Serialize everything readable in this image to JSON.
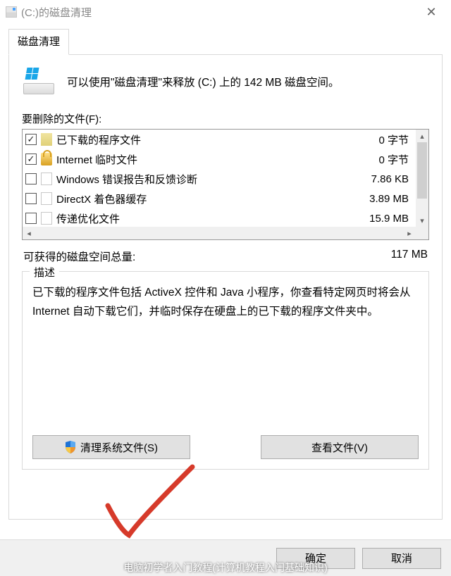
{
  "window": {
    "title": "(C:)的磁盘清理"
  },
  "tab": {
    "label": "磁盘清理"
  },
  "intro": {
    "text": "可以使用\"磁盘清理\"来释放  (C:) 上的 142 MB 磁盘空间。"
  },
  "files": {
    "label": "要删除的文件(F):",
    "items": [
      {
        "checked": true,
        "icon": "folder",
        "name": "已下载的程序文件",
        "size": "0 字节"
      },
      {
        "checked": true,
        "icon": "lock",
        "name": "Internet 临时文件",
        "size": "0 字节"
      },
      {
        "checked": false,
        "icon": "page",
        "name": "Windows 错误报告和反馈诊断",
        "size": "7.86 KB"
      },
      {
        "checked": false,
        "icon": "page",
        "name": "DirectX 着色器缓存",
        "size": "3.89 MB"
      },
      {
        "checked": false,
        "icon": "page",
        "name": "传递优化文件",
        "size": "15.9 MB"
      }
    ]
  },
  "total": {
    "label": "可获得的磁盘空间总量:",
    "value": "117 MB"
  },
  "description": {
    "title": "描述",
    "text": "已下载的程序文件包括 ActiveX 控件和 Java 小程序，你查看特定网页时将会从 Internet 自动下载它们，并临时保存在硬盘上的已下载的程序文件夹中。"
  },
  "buttons": {
    "clean_system": "清理系统文件(S)",
    "view_files": "查看文件(V)",
    "ok": "确定",
    "cancel": "取消"
  },
  "caption": "电脑初学者入门教程(计算机教程入门基础知识)"
}
